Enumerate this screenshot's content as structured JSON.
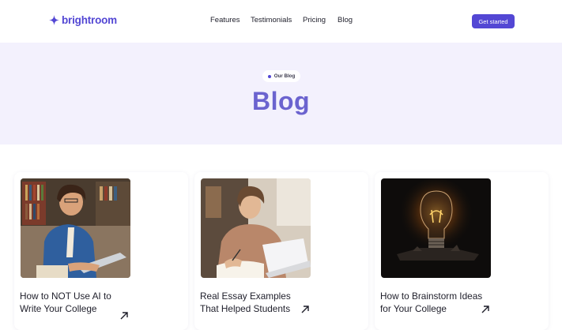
{
  "brand": {
    "name": "brightroom",
    "color": "#5347d4"
  },
  "nav": {
    "links": [
      "Features",
      "Testimonials",
      "Pricing",
      "Blog"
    ],
    "cta_label": "Get started"
  },
  "hero": {
    "chip_label": "Our Blog",
    "title": "Blog"
  },
  "posts": [
    {
      "title": "How to NOT Use AI to Write Your College",
      "image": "student-laptop-library-photo"
    },
    {
      "title": "Real Essay Examples That Helped Students",
      "image": "student-writing-notebook-photo"
    },
    {
      "title": "How to Brainstorm Ideas for Your College",
      "image": "lightbulb-photo"
    }
  ]
}
